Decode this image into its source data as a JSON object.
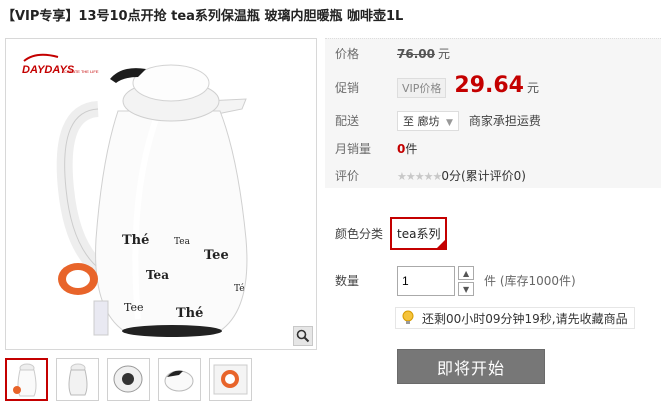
{
  "title": "【VIP专享】13号10点开抢 tea系列保温瓶 玻璃内胆暖瓶 咖啡壶1L",
  "brand": {
    "logo_text": "DAYDAYS",
    "tagline": "CREATE THE LIFE"
  },
  "product_image": {
    "flask_words": [
      "Thé",
      "Tea",
      "Tee",
      "Tea",
      "Tee",
      "Thé",
      "Té"
    ]
  },
  "zoom_icon": "magnifier-icon",
  "price": {
    "label": "价格",
    "original": "76.00",
    "unit": "元"
  },
  "promo": {
    "label": "促销",
    "tag": "VIP价格",
    "value": "29.64",
    "unit": "元"
  },
  "delivery": {
    "label": "配送",
    "destination": "至 廊坊",
    "note": "商家承担运费"
  },
  "sales": {
    "label": "月销量",
    "count": "0",
    "unit": "件"
  },
  "rating": {
    "label": "评价",
    "stars": "★★★★★",
    "score": "0分",
    "summary": "(累计评价0)"
  },
  "sku": {
    "label": "颜色分类",
    "selected": "tea系列"
  },
  "quantity": {
    "label": "数量",
    "value": "1",
    "stock": "件 (库存1000件)"
  },
  "countdown": {
    "text": "还剩00小时09分钟19秒,请先收藏商品"
  },
  "buy_button": {
    "label": "即将开始"
  },
  "colors": {
    "accent": "#c40000",
    "button": "#777777"
  }
}
